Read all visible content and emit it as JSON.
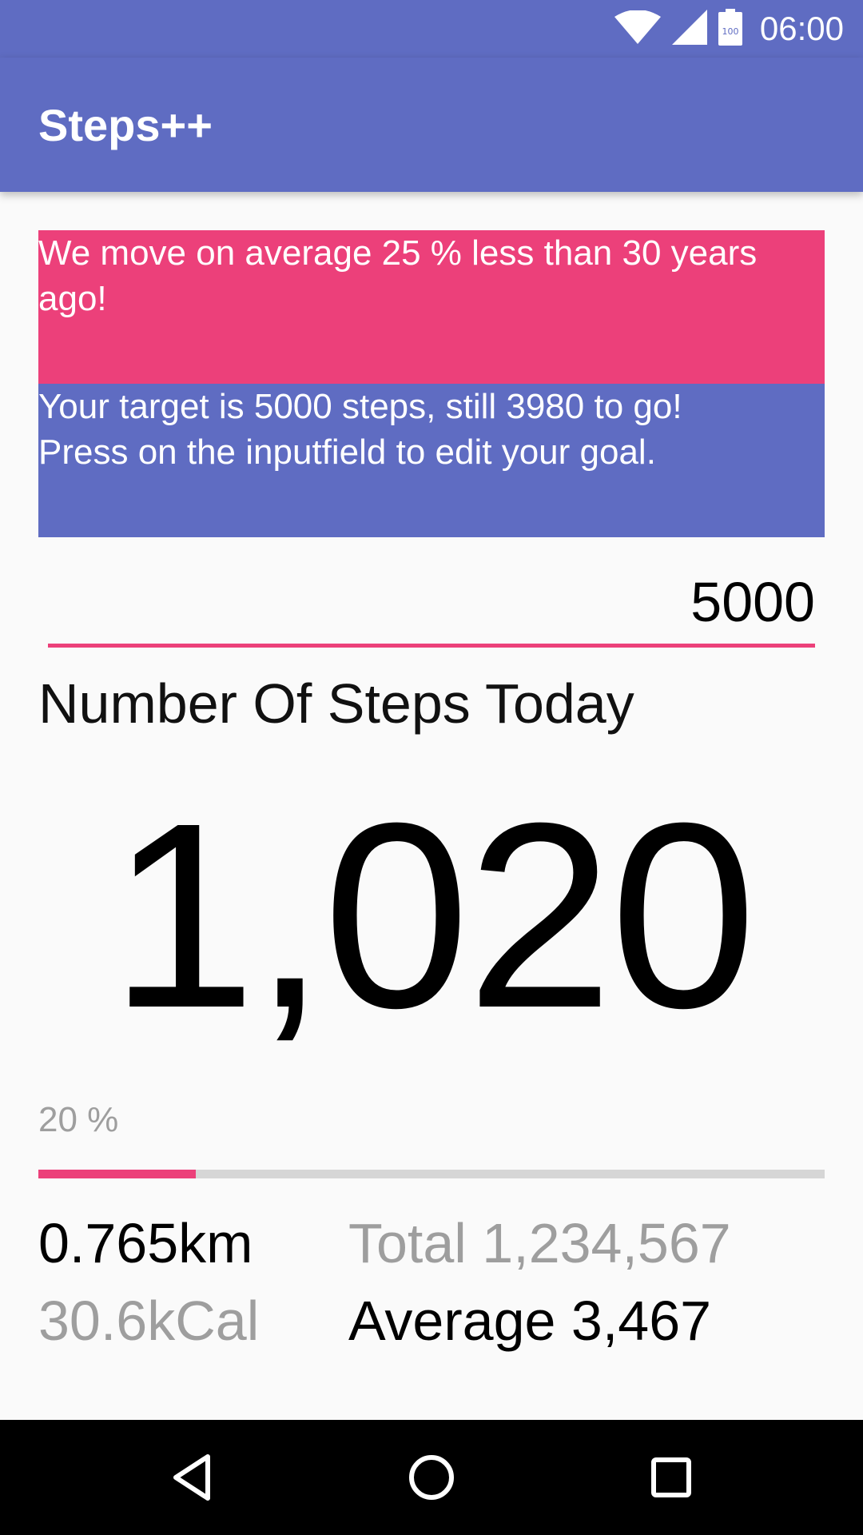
{
  "status_bar": {
    "time": "06:00",
    "battery": "100"
  },
  "app": {
    "title": "Steps++"
  },
  "cards": {
    "fact": "We move on average 25 % less than 30 years ago!",
    "target": "Your target is 5000 steps, still 3980 to go!\nPress on the inputfield to edit your goal."
  },
  "goal_input": {
    "value": "5000"
  },
  "steps": {
    "heading": "Number Of Steps Today",
    "count": "1,020",
    "percent_label": "20 %",
    "progress_fraction": 0.2
  },
  "stats": {
    "distance": "0.765km",
    "calories": "30.6kCal",
    "total": "Total 1,234,567",
    "average": "Average 3,467"
  },
  "colors": {
    "primary": "#5f6cc2",
    "accent": "#ec407a",
    "grey_text": "#9e9e9e"
  },
  "icons": {
    "wifi": "wifi-icon",
    "signal": "signal-icon",
    "battery": "battery-icon",
    "back": "back-icon",
    "home": "home-icon",
    "recents": "recents-icon"
  }
}
